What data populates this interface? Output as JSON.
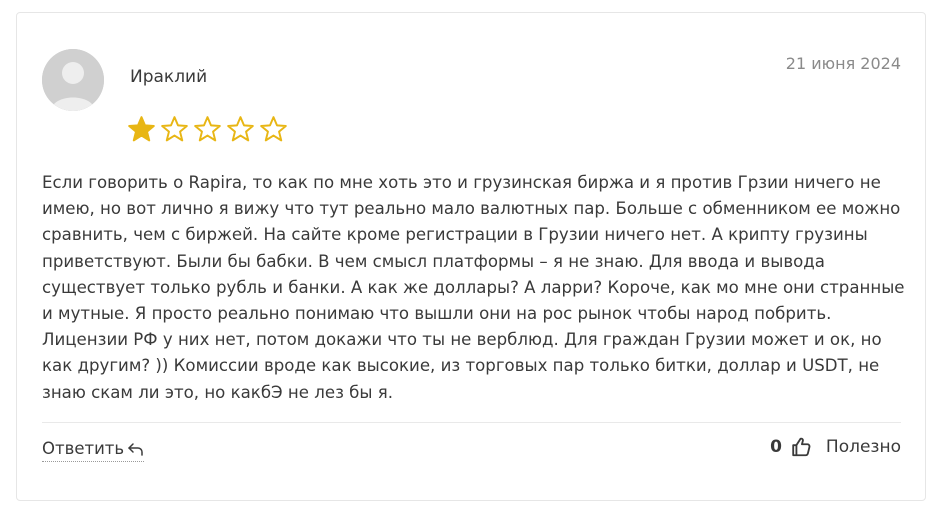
{
  "review": {
    "author": "Ираклий",
    "date": "21 июня 2024",
    "rating": 1,
    "max_rating": 5,
    "text": "Если говорить о Rapira, то как по мне хоть это и грузинская биржа и я против Грзии ничего не имею, но вот лично я вижу что тут реально мало валютных пар. Больше с обменником ее можно сравнить, чем с биржей. На сайте кроме регистрации в Грузии ничего нет. А крипту грузины приветствуют. Были бы бабки. В чем смысл платформы – я не знаю. Для ввода и вывода существует только рубль и банки. А как же доллары? А ларри? Короче, как мо мне они странные и мутные. Я просто реально понимаю что вышли они на рос рынок чтобы народ побрить. Лицензии РФ у них нет, потом докажи что ты не верблюд. Для граждан Грузии может и ок, но как другим? )) Комиссии вроде как высокие, из торговых пар только битки, доллар и USDT, не знаю скам ли это, но какбЭ не лез бы я."
  },
  "actions": {
    "reply_label": "Ответить",
    "likes_count": "0",
    "helpful_label": "Полезно"
  },
  "icons": {
    "avatar": "user-avatar-placeholder",
    "star_filled": "star-filled-icon",
    "star_empty": "star-outline-icon",
    "reply": "reply-arrow-icon",
    "thumb": "thumbs-up-icon"
  },
  "colors": {
    "star": "#e8b614",
    "text": "#3a3a3a",
    "date": "#8a8a8a",
    "avatar_bg": "#d0d0d0"
  }
}
